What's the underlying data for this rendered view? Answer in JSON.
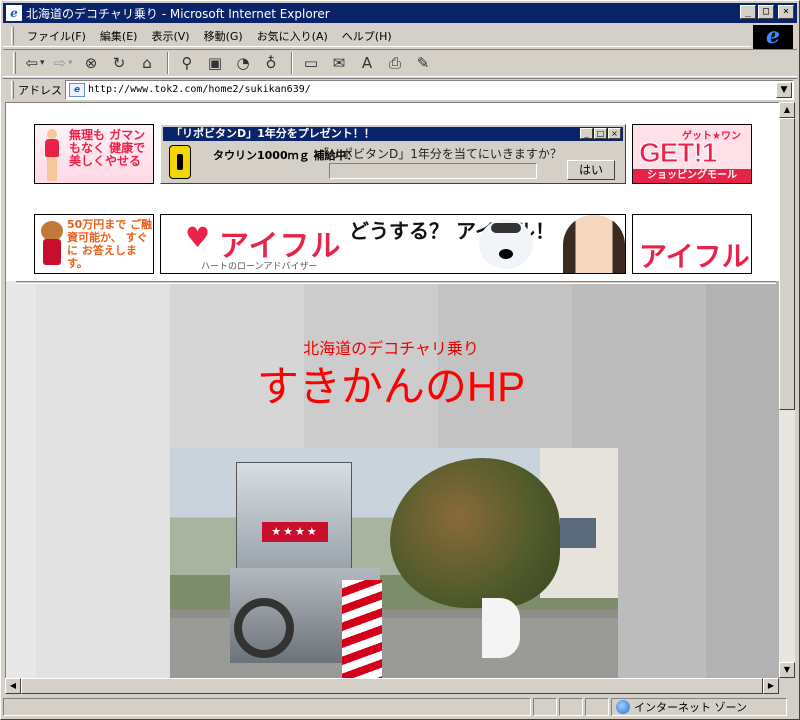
{
  "window": {
    "title": "北海道のデコチャリ乗り - Microsoft Internet Explorer",
    "controls": [
      "minimize",
      "maximize",
      "close"
    ]
  },
  "menu": [
    "ファイル(F)",
    "編集(E)",
    "表示(V)",
    "移動(G)",
    "お気に入り(A)",
    "ヘルプ(H)"
  ],
  "toolbar": {
    "icons": [
      "back-icon",
      "forward-icon",
      "stop-icon",
      "refresh-icon",
      "home-icon",
      "search-icon",
      "favorites-icon",
      "history-icon",
      "channels-icon",
      "fullscreen-icon",
      "mail-icon",
      "font-icon",
      "print-icon",
      "edit-icon"
    ]
  },
  "address": {
    "label": "アドレス",
    "url": "http://www.tok2.com/home2/sukikan639/"
  },
  "ads": {
    "ad1_text": "無理も ガマンもなく 健康で 美しくやせる",
    "popup_title": "「リポビタンD」1年分をプレゼント！！",
    "popup_taurine": "タウリン1000ｍｇ 補給中：",
    "popup_question": "「リポビタンD」1年分を当てにいきますか？",
    "popup_yes": "はい",
    "ad3_top": "ゲット★ワン",
    "ad3_get": "GET!1",
    "ad3_bottom": "ショッピングモール",
    "ad4_text": "50万円まで ご融資可能か、 すぐに お答えします。",
    "ad5_brand": "アイフル",
    "ad5_sub": "ハートのローンアドバイザー",
    "ad5_copy": "どうする？ アイフル！",
    "ad6_brand": "アイフル"
  },
  "page": {
    "subtitle": "北海道のデコチャリ乗り",
    "title": "すきかんのHP",
    "photo_alt": "decorated bicycle photo"
  },
  "status": {
    "zone": "インターネット ゾーン"
  },
  "colors": {
    "titlebar": "#0a246a",
    "heading": "#ff0000",
    "chrome": "#d4d0c8"
  }
}
